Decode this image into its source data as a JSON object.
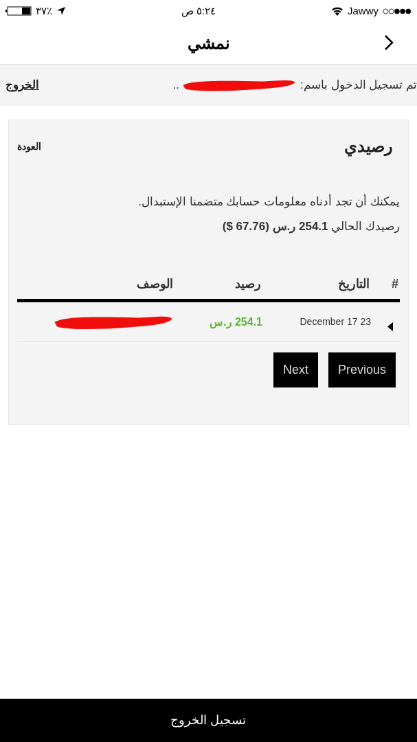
{
  "status_bar": {
    "battery": "٣٧٪",
    "time": "٥:٢٤ ص",
    "carrier": "Jawwy"
  },
  "nav": {
    "title": "نمشي"
  },
  "login_bar": {
    "label": "تم تسجيل الدخول باسم:",
    "ellipsis": "..",
    "logout": "الخروج"
  },
  "card": {
    "title": "رصيدي",
    "back": "العودة",
    "intro": "يمكنك أن تجد أدناه معلومات حسابك متضمنا الإستبدال.",
    "balance": "رصيدك الحالي **254.1 ر.س (67.76 $)**",
    "table": {
      "columns": [
        "#",
        "التاريخ",
        "رصيد",
        "الوصف"
      ],
      "rows": [
        {
          "date": "December 17 23",
          "amount": "254.1 ر.س"
        }
      ]
    },
    "buttons": [
      "Previous",
      "Next"
    ]
  },
  "bottom_bar": {
    "label": "تسجيل الخروج"
  }
}
